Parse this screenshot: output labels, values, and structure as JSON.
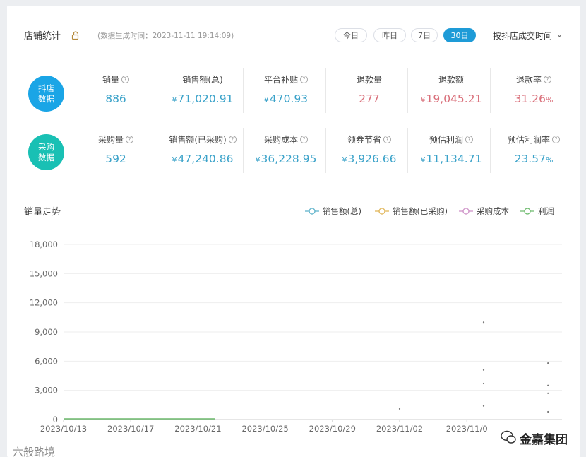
{
  "header": {
    "title": "店铺统计",
    "generated": "(数据生成时间：2023-11-11 19:14:09)",
    "ranges": [
      "今日",
      "昨日",
      "7日",
      "30日"
    ],
    "active_range": "30日",
    "sort_label": "按抖店成交时间"
  },
  "stats": {
    "douyin": {
      "badge": "抖店\n数据",
      "items": [
        {
          "label": "销量",
          "value": "886",
          "currency": "",
          "unit": "",
          "help": true
        },
        {
          "label": "销售额(总)",
          "value": "71,020.91",
          "currency": "¥",
          "unit": "",
          "help": false
        },
        {
          "label": "平台补贴",
          "value": "470.93",
          "currency": "¥",
          "unit": "",
          "help": true
        },
        {
          "label": "退款量",
          "value": "277",
          "currency": "",
          "unit": "",
          "help": false
        },
        {
          "label": "退款额",
          "value": "19,045.21",
          "currency": "¥",
          "unit": "",
          "help": false
        },
        {
          "label": "退款率",
          "value": "31.26",
          "currency": "",
          "unit": "%",
          "help": true
        }
      ]
    },
    "purchase": {
      "badge": "采购\n数据",
      "items": [
        {
          "label": "采购量",
          "value": "592",
          "currency": "",
          "unit": "",
          "help": true
        },
        {
          "label": "销售额(已采购)",
          "value": "47,240.86",
          "currency": "¥",
          "unit": "",
          "help": true
        },
        {
          "label": "采购成本",
          "value": "36,228.95",
          "currency": "¥",
          "unit": "",
          "help": true
        },
        {
          "label": "领券节省",
          "value": "3,926.66",
          "currency": "¥",
          "unit": "",
          "help": true
        },
        {
          "label": "预估利润",
          "value": "11,134.71",
          "currency": "¥",
          "unit": "",
          "help": true
        },
        {
          "label": "预估利润率",
          "value": "23.57",
          "currency": "",
          "unit": "%",
          "help": true
        }
      ]
    }
  },
  "chart_section_title": "销量走势",
  "legend": [
    {
      "name": "销售额(总)",
      "color": "#5ab1c9"
    },
    {
      "name": "销售额(已采购)",
      "color": "#e0b455"
    },
    {
      "name": "采购成本",
      "color": "#cd8fc6"
    },
    {
      "name": "利润",
      "color": "#6dba6d"
    }
  ],
  "chart_data": {
    "type": "line",
    "title": "",
    "xlabel": "",
    "ylabel": "",
    "ylim": [
      0,
      18000
    ],
    "yticks": [
      "0",
      "3,000",
      "6,000",
      "9,000",
      "12,000",
      "15,000",
      "18,000"
    ],
    "ytick_values": [
      0,
      3000,
      6000,
      9000,
      12000,
      15000,
      18000
    ],
    "x_tick_labels": [
      "2023/10/13",
      "2023/10/17",
      "2023/10/21",
      "2023/10/25",
      "2023/10/29",
      "2023/11/02",
      "2023/11/0"
    ],
    "x_dates": [
      "2023/10/13",
      "2023/10/14",
      "2023/10/15",
      "2023/10/16",
      "2023/10/17",
      "2023/10/18",
      "2023/10/19",
      "2023/10/20",
      "2023/10/21",
      "2023/10/22",
      "2023/10/23",
      "2023/10/24",
      "2023/10/25",
      "2023/10/26",
      "2023/10/27",
      "2023/10/28",
      "2023/10/29",
      "2023/10/30",
      "2023/10/31",
      "2023/11/01",
      "2023/11/02",
      "2023/11/03",
      "2023/11/04",
      "2023/11/05",
      "2023/11/06",
      "2023/11/07",
      "2023/11/08",
      "2023/11/09",
      "2023/11/10",
      "2023/11/11"
    ],
    "grid": true,
    "series": [
      {
        "name": "销售额(总)",
        "color": "#5ab1c9",
        "values": [
          0,
          0,
          0,
          0,
          0,
          0,
          0,
          0,
          0,
          0,
          0,
          0,
          0,
          0,
          0,
          0,
          0,
          0,
          0,
          0,
          1100,
          0,
          0,
          0,
          0,
          10000,
          0,
          0,
          0,
          5800
        ]
      },
      {
        "name": "销售额(已采购)",
        "color": "#e0b455",
        "values": [
          0,
          0,
          0,
          0,
          0,
          0,
          0,
          0,
          0,
          0,
          0,
          0,
          0,
          0,
          0,
          0,
          0,
          0,
          0,
          0,
          0,
          0,
          0,
          0,
          0,
          5100,
          0,
          0,
          0,
          3500
        ]
      },
      {
        "name": "采购成本",
        "color": "#cd8fc6",
        "values": [
          0,
          0,
          0,
          0,
          0,
          0,
          0,
          0,
          0,
          0,
          0,
          0,
          0,
          0,
          0,
          0,
          0,
          0,
          0,
          0,
          0,
          0,
          0,
          0,
          0,
          3700,
          0,
          0,
          0,
          2700
        ]
      },
      {
        "name": "利润",
        "color": "#6dba6d",
        "values": [
          0,
          0,
          0,
          0,
          0,
          0,
          0,
          0,
          0,
          0,
          0,
          0,
          0,
          0,
          0,
          0,
          0,
          0,
          0,
          0,
          0,
          0,
          0,
          0,
          0,
          1400,
          0,
          0,
          0,
          800
        ]
      }
    ]
  },
  "watermarks": {
    "left": "六般路境",
    "right": "金嘉集团"
  }
}
